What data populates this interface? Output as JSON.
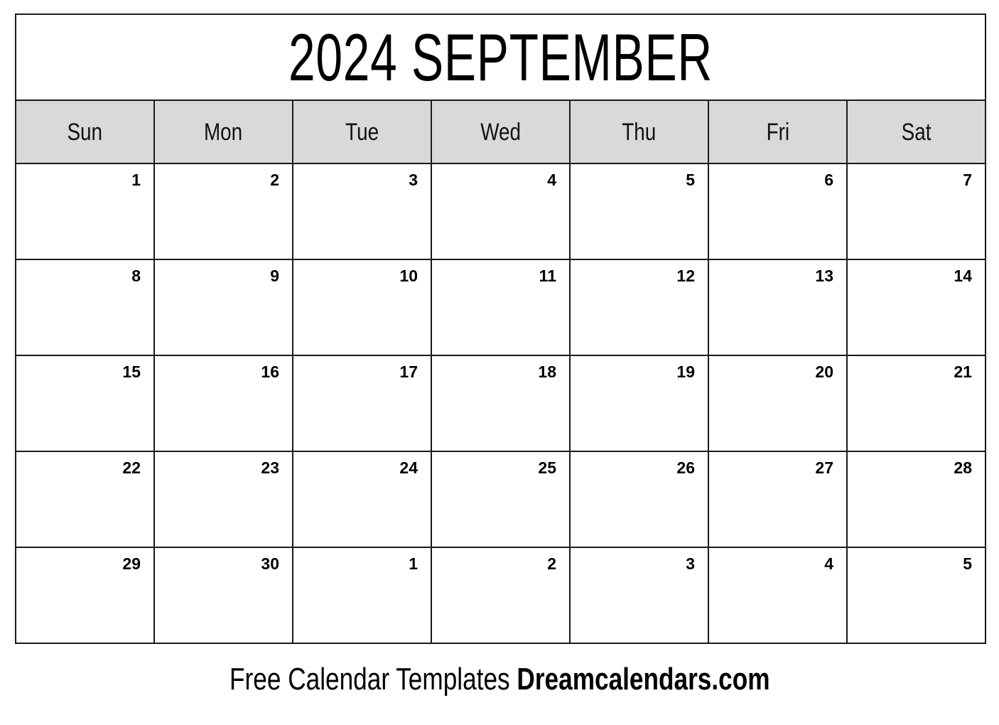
{
  "calendar": {
    "title": "2024 SEPTEMBER",
    "year": "2024",
    "month": "SEPTEMBER",
    "weekdays": [
      {
        "label": "Sun"
      },
      {
        "label": "Mon"
      },
      {
        "label": "Tue"
      },
      {
        "label": "Wed"
      },
      {
        "label": "Thu"
      },
      {
        "label": "Fri"
      },
      {
        "label": "Sat"
      }
    ],
    "weeks": [
      {
        "days": [
          {
            "num": "1"
          },
          {
            "num": "2"
          },
          {
            "num": "3"
          },
          {
            "num": "4"
          },
          {
            "num": "5"
          },
          {
            "num": "6"
          },
          {
            "num": "7"
          }
        ]
      },
      {
        "days": [
          {
            "num": "8"
          },
          {
            "num": "9"
          },
          {
            "num": "10"
          },
          {
            "num": "11"
          },
          {
            "num": "12"
          },
          {
            "num": "13"
          },
          {
            "num": "14"
          }
        ]
      },
      {
        "days": [
          {
            "num": "15"
          },
          {
            "num": "16"
          },
          {
            "num": "17"
          },
          {
            "num": "18"
          },
          {
            "num": "19"
          },
          {
            "num": "20"
          },
          {
            "num": "21"
          }
        ]
      },
      {
        "days": [
          {
            "num": "22"
          },
          {
            "num": "23"
          },
          {
            "num": "24"
          },
          {
            "num": "25"
          },
          {
            "num": "26"
          },
          {
            "num": "27"
          },
          {
            "num": "28"
          }
        ]
      },
      {
        "days": [
          {
            "num": "29"
          },
          {
            "num": "30"
          },
          {
            "num": "1"
          },
          {
            "num": "2"
          },
          {
            "num": "3"
          },
          {
            "num": "4"
          },
          {
            "num": "5"
          }
        ]
      }
    ],
    "colors": {
      "header_background": "#d9d9d9",
      "cell_background": "#ffffff",
      "border": "#1a1a1a",
      "text": "#000000"
    }
  },
  "footer": {
    "tagline": "Free Calendar Templates",
    "brand": "Dreamcalendars.com"
  }
}
